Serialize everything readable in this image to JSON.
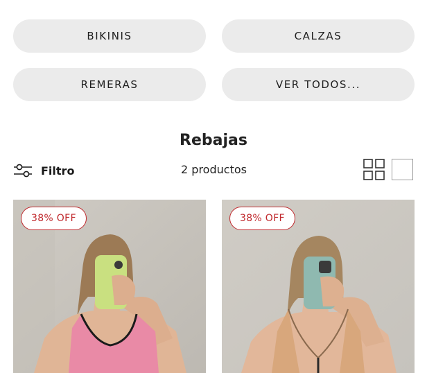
{
  "categories": [
    {
      "label": "BIKINIS"
    },
    {
      "label": "CALZAS"
    },
    {
      "label": "REMERAS"
    },
    {
      "label": "VER TODOS..."
    }
  ],
  "section": {
    "title": "Rebajas"
  },
  "toolbar": {
    "filter_label": "Filtro",
    "product_count": "2 productos",
    "filter_icon": "sliders-icon",
    "grid_view_icon": "grid-view-icon",
    "single_view_icon": "single-view-icon"
  },
  "products": [
    {
      "badge": "38% OFF",
      "top_color": "#e98aa6"
    },
    {
      "badge": "38% OFF",
      "top_color": "#d8a77c"
    }
  ],
  "colors": {
    "badge_red": "#c0282c",
    "button_bg": "#ebebeb"
  }
}
